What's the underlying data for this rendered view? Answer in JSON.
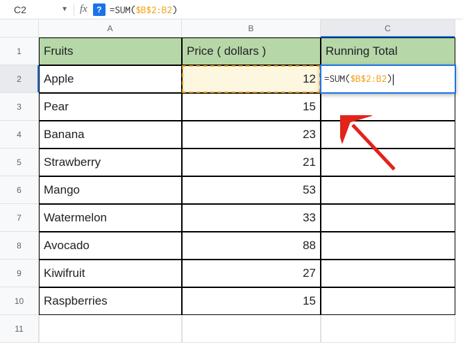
{
  "formula_bar": {
    "cell_ref": "C2",
    "fx_label": "fx",
    "help": "?",
    "formula": {
      "eq": "=",
      "fn": "SUM",
      "open": "(",
      "ref": "$B$2:B2",
      "close": ")"
    }
  },
  "columns": [
    "A",
    "B",
    "C"
  ],
  "rows_shown": [
    "1",
    "2",
    "3",
    "4",
    "5",
    "6",
    "7",
    "8",
    "9",
    "10",
    "11"
  ],
  "headers": {
    "a": "Fruits",
    "b": "Price ( dollars )",
    "c": "Running Total"
  },
  "data": [
    {
      "fruit": "Apple",
      "price": "12"
    },
    {
      "fruit": "Pear",
      "price": "15"
    },
    {
      "fruit": "Banana",
      "price": "23"
    },
    {
      "fruit": "Strawberry",
      "price": "21"
    },
    {
      "fruit": "Mango",
      "price": "53"
    },
    {
      "fruit": "Watermelon",
      "price": "33"
    },
    {
      "fruit": "Avocado",
      "price": "88"
    },
    {
      "fruit": "Kiwifruit",
      "price": "27"
    },
    {
      "fruit": "Raspberries",
      "price": "15"
    }
  ],
  "edit_cell": {
    "eq": "=",
    "fn": "SUM",
    "open": "(",
    "ref": "$B$2:B2",
    "close": ")"
  }
}
